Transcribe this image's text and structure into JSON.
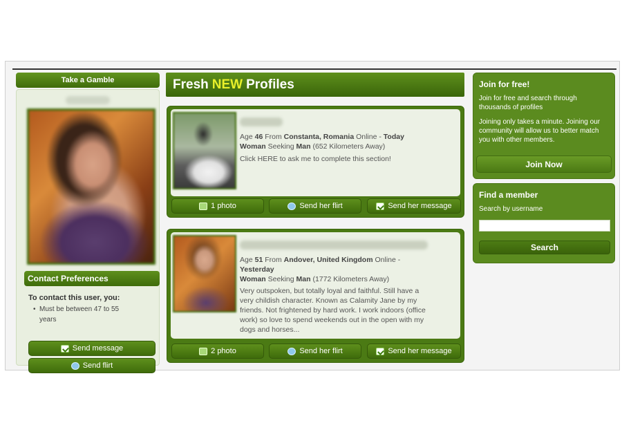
{
  "left": {
    "gamble_label": "Take a Gamble",
    "contact_title": "Contact Preferences",
    "contact_intro": "To contact this user, you:",
    "contact_rule": "Must be between 47 to 55 years",
    "send_message_label": "Send message",
    "send_flirt_label": "Send flirt"
  },
  "center": {
    "title_fresh": "Fresh",
    "title_new": "NEW",
    "title_profiles": "Profiles",
    "profiles": [
      {
        "age_label": "Age",
        "age": "46",
        "from_label": "From",
        "location": "Constanta, Romania",
        "online_label": "Online -",
        "online_when": "Today",
        "gender": "Woman",
        "seeking_label": "Seeking",
        "seeking": "Man",
        "distance": "(652 Kilometers Away)",
        "description": "Click HERE to ask me to complete this section!",
        "photo_label": "1 photo",
        "flirt_label": "Send her flirt",
        "message_label": "Send her message"
      },
      {
        "age_label": "Age",
        "age": "51",
        "from_label": "From",
        "location": "Andover, United Kingdom",
        "online_label": "Online -",
        "online_when": "Yesterday",
        "gender": "Woman",
        "seeking_label": "Seeking",
        "seeking": "Man",
        "distance": "(1772 Kilometers Away)",
        "description": "Very outspoken, but totally loyal and faithful. Still have a very childish character. Known as Calamity Jane by my friends. Not frightened by hard work. I work indoors (office work) so love to spend weekends out in the open with my dogs and horses...",
        "photo_label": "2 photo",
        "flirt_label": "Send her flirt",
        "message_label": "Send her message"
      }
    ]
  },
  "right": {
    "join_title": "Join for free!",
    "join_text1": "Join for free and search through thousands of profiles",
    "join_text2": "Joining only takes a minute. Joining our community will allow us to better match you with other members.",
    "join_button": "Join Now",
    "find_title": "Find a member",
    "find_sub": "Search by username",
    "find_input_value": "",
    "search_button": "Search"
  },
  "colors": {
    "brand_green": "#4b7a14",
    "highlight_yellow": "#e8ef2a",
    "panel_bg": "#ecf1e5"
  }
}
